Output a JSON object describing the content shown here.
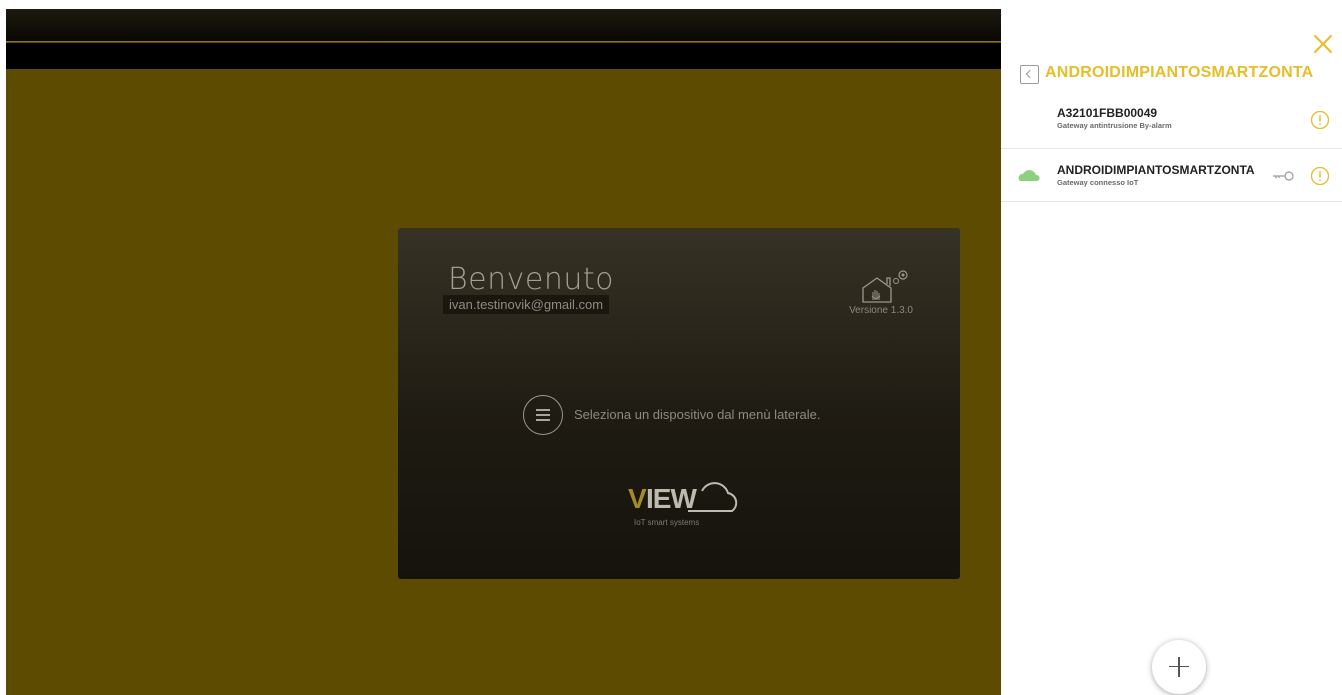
{
  "colors": {
    "app_background": "#5c4b00",
    "accent": "#e6bd2a",
    "card_background": "#363225",
    "cloud_online": "#8cd17d"
  },
  "welcome": {
    "title": "Benvenuto",
    "email": "ivan.testinovik@gmail.com",
    "version": "Versione 1.3.0",
    "hint": "Seleziona un dispositivo dal menù laterale.",
    "logo_brand_v": "V",
    "logo_brand_rest": "IEW",
    "logo_tagline": "IoT smart systems",
    "icons": {
      "settings": "home-settings-icon",
      "menu": "menu-icon",
      "logo": "cloud-icon"
    }
  },
  "panel": {
    "title": "ANDROIDIMPIANTOSMARTZONTA",
    "icons": {
      "close": "close-icon",
      "back": "chevron-left-icon",
      "add": "plus-icon"
    },
    "devices": [
      {
        "name": "A32101FBB00049",
        "subtitle": "Gateway antintrusione By-alarm",
        "status_icon": "info-icon"
      },
      {
        "name": "ANDROIDIMPIANTOSMARTZONTA",
        "subtitle": "Gateway connesso IoT",
        "connection_icon": "cloud-icon",
        "key_icon": "key-icon",
        "status_icon": "info-icon"
      }
    ]
  }
}
